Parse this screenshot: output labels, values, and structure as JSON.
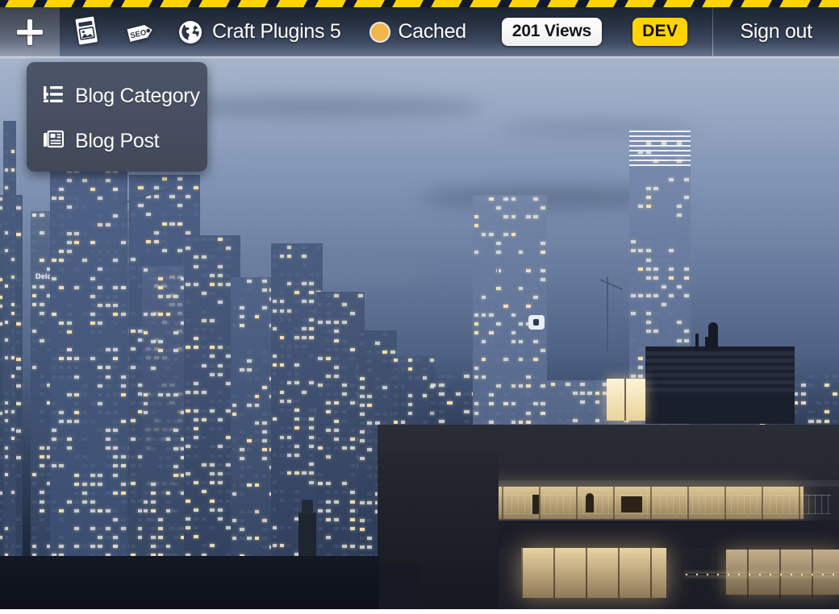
{
  "toolbar": {
    "add_button": {
      "label": "+",
      "icon": "plus-icon"
    },
    "guide_button": {
      "label": "Guide",
      "icon": "guide-document-icon"
    },
    "seo_button": {
      "label": "SEO",
      "icon": "seo-tag-icon"
    },
    "site": {
      "label": "Craft Plugins 5",
      "icon": "globe-icon"
    },
    "cache_status": {
      "label": "Cached",
      "dot_color": "#F2B64D",
      "icon": "status-dot-icon"
    },
    "views_badge": {
      "label": "201 Views"
    },
    "env_badge": {
      "label": "DEV",
      "background": "#FFD400",
      "text_color": "#101010"
    },
    "signout_button": {
      "label": "Sign out"
    }
  },
  "add_menu": {
    "items": [
      {
        "label": "Blog Category",
        "icon": "structure-list-icon"
      },
      {
        "label": "Blog Post",
        "icon": "newspaper-icon"
      }
    ]
  },
  "hazard_stripe": {
    "color": "#FFD400",
    "background": "#11182a"
  },
  "background_photo": {
    "description": "City skyline at dusk with lit office towers and a foreground rooftop apartment building",
    "landmark_text": "Deloitte."
  }
}
